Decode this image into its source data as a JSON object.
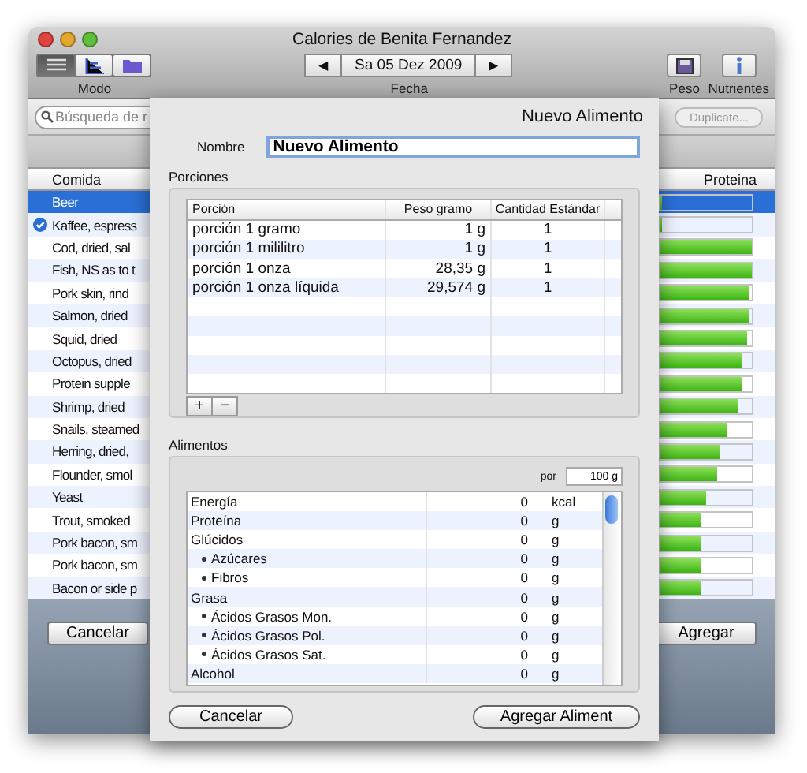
{
  "window": {
    "title": "Calories de Benita Fernandez"
  },
  "toolbar": {
    "modes": [
      {
        "selected": true
      },
      {
        "selected": false
      },
      {
        "selected": false
      }
    ],
    "mode_label": "Modo",
    "date": "Sa 05 Dez 2009",
    "prev": "◀",
    "next": "▶",
    "date_label": "Fecha",
    "buttons": [
      "Peso",
      "Nutrientes"
    ]
  },
  "search": {
    "placeholder": "Búsqueda de r"
  },
  "duplicate_button": "Duplicate...",
  "table": {
    "columns": [
      "Comida",
      "Proteina"
    ],
    "rows": [
      {
        "name": "Beer",
        "selected": true,
        "checked": false,
        "level": 0
      },
      {
        "name": "Kaffee, espress",
        "selected": false,
        "checked": true,
        "level": 0
      },
      {
        "name": "Cod, dried, sal",
        "selected": false,
        "checked": false,
        "level": 1
      },
      {
        "name": "Fish, NS as to t",
        "selected": false,
        "checked": false,
        "level": 1
      },
      {
        "name": "Pork skin, rind",
        "selected": false,
        "checked": false,
        "level": 0.97
      },
      {
        "name": "Salmon, dried",
        "selected": false,
        "checked": false,
        "level": 0.97
      },
      {
        "name": "Squid, dried",
        "selected": false,
        "checked": false,
        "level": 0.95
      },
      {
        "name": "Octopus, dried",
        "selected": false,
        "checked": false,
        "level": 0.9
      },
      {
        "name": "Protein supple",
        "selected": false,
        "checked": false,
        "level": 0.9
      },
      {
        "name": "Shrimp, dried",
        "selected": false,
        "checked": false,
        "level": 0.85
      },
      {
        "name": "Snails, steamed",
        "selected": false,
        "checked": false,
        "level": 0.72
      },
      {
        "name": "Herring, dried,",
        "selected": false,
        "checked": false,
        "level": 0.65
      },
      {
        "name": "Flounder, smol",
        "selected": false,
        "checked": false,
        "level": 0.62
      },
      {
        "name": "Yeast",
        "selected": false,
        "checked": false,
        "level": 0.5
      },
      {
        "name": "Trout, smoked",
        "selected": false,
        "checked": false,
        "level": 0.45
      },
      {
        "name": "Pork bacon, sm",
        "selected": false,
        "checked": false,
        "level": 0.45
      },
      {
        "name": "Pork bacon, sm",
        "selected": false,
        "checked": false,
        "level": 0.45
      },
      {
        "name": "Bacon or side p",
        "selected": false,
        "checked": false,
        "level": 0.45
      }
    ]
  },
  "main_buttons": [
    "Cancelar",
    "Agregar"
  ],
  "sheet": {
    "title": "Nuevo Alimento",
    "name_label": "Nombre",
    "name_value": "Nuevo Alimento",
    "portions_label": "Porciones",
    "portion_columns": [
      "Porción",
      "Peso gramo",
      "Cantidad Estándar"
    ],
    "portions": [
      {
        "name": "porción 1 gramo",
        "weight": "1 g",
        "amount": "1"
      },
      {
        "name": "porción 1 mililitro",
        "weight": "1 g",
        "amount": "1"
      },
      {
        "name": "porción 1 onza",
        "weight": "28,35 g",
        "amount": "1"
      },
      {
        "name": "porción 1 onza líquida",
        "weight": "29,574 g",
        "amount": "1"
      }
    ],
    "add": "+",
    "remove": "−",
    "foods_label": "Alimentos",
    "per_label": "por",
    "per_value": "100 g",
    "nutrients": [
      {
        "name": "Energía",
        "value": "0",
        "unit": "kcal"
      },
      {
        "name": "Proteína",
        "value": "0",
        "unit": "g"
      },
      {
        "name": "Glúcidos",
        "value": "0",
        "unit": "g",
        "children": [
          {
            "name": "Azúcares",
            "value": "0",
            "unit": "g"
          },
          {
            "name": "Fibros",
            "value": "0",
            "unit": "g"
          }
        ]
      },
      {
        "name": "Grasa",
        "value": "0",
        "unit": "g",
        "children": [
          {
            "name": "Ácidos Grasos Mon.",
            "value": "0",
            "unit": "g"
          },
          {
            "name": "Ácidos Grasos Pol.",
            "value": "0",
            "unit": "g"
          },
          {
            "name": "Ácidos Grasos Sat.",
            "value": "0",
            "unit": "g"
          }
        ]
      },
      {
        "name": "Alcohol",
        "value": "0",
        "unit": "g"
      }
    ],
    "buttons": [
      "Cancelar",
      "Agregar Aliment"
    ]
  }
}
